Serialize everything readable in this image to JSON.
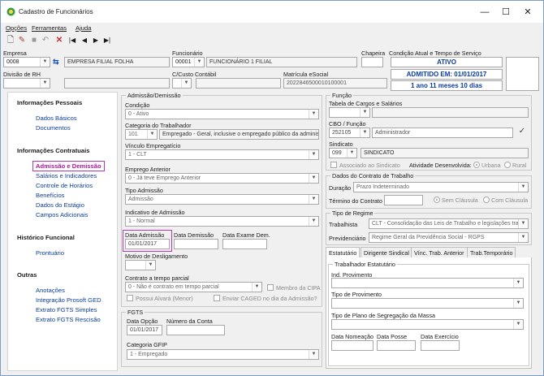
{
  "window": {
    "title": "Cadastro de Funcionários",
    "minimize": "—",
    "maximize": "☐",
    "close": "✕"
  },
  "menu": [
    "Opções",
    "Ferramentas",
    "Ajuda"
  ],
  "toolbar": {
    "new": "🗋",
    "edit": "✎",
    "save": "■",
    "undo": "↶",
    "delete": "✕",
    "first": "|◀",
    "prev": "◀",
    "next": "▶",
    "last": "▶|"
  },
  "header": {
    "empresa_label": "Empresa",
    "empresa_code": "0008",
    "empresa_name": "EMPRESA FILIAL FOLHA",
    "funcionario_label": "Funcionário",
    "funcionario_code": "00001",
    "funcionario_name": "FUNCIONÁRIO 1 FILIAL",
    "chapeira_label": "Chapeira",
    "condicao_label": "Condição Atual e Tempo de Serviço",
    "status": "ATIVO",
    "admitido": "ADMITIDO EM: 01/01/2017",
    "tempo": "1 ano 11 meses 10 dias",
    "divisao_label": "Divisão de RH",
    "custo_label": "C/Custo Contábil",
    "matricula_label": "Matrícula eSocial",
    "matricula_value": "2022846500010100001"
  },
  "sidebar": {
    "sections": [
      {
        "title": "Informações Pessoais",
        "items": [
          "Dados Básicos",
          "Documentos"
        ]
      },
      {
        "title": "Informações Contratuais",
        "items": [
          "Admissão e Demissão",
          "Salários e Indicadores",
          "Controle de Horários",
          "Benefícios",
          "Dados do Estágio",
          "Campos Adicionais"
        ]
      },
      {
        "title": "Histórico Funcional",
        "items": [
          "Prontuário"
        ]
      },
      {
        "title": "Outras",
        "items": [
          "Anotações",
          "Integração Prosoft GED",
          "Extrato FGTS Simples",
          "Extrato FGTS Rescisão"
        ]
      }
    ]
  },
  "admissao": {
    "group_title": "Admissão/Demissão",
    "condicao_label": "Condição",
    "condicao_value": "0 - Ativo",
    "categoria_label": "Categoria do Trabalhador",
    "categoria_code": "101",
    "categoria_desc": "Empregado - Geral, inclusive o empregado público da administ",
    "vinculo_label": "Vínculo Empregatício",
    "vinculo_value": "1 - CLT",
    "emprego_label": "Emprego Anterior",
    "emprego_value": "0 - Já teve Emprego Anterior",
    "tipo_admissao_label": "Tipo Admissão",
    "tipo_admissao_value": "Admissão",
    "indicativo_label": "Indicativo de Admissão",
    "indicativo_value": "1 - Normal",
    "data_admissao_label": "Data Admissão",
    "data_admissao_value": "01/01/2017",
    "data_demissao_label": "Data Demissão",
    "data_exame_label": "Data Exame Dem.",
    "motivo_label": "Motivo de Desligamento",
    "contrato_parcial_label": "Contrato a tempo parcial",
    "contrato_parcial_value": "0 - Não é contrato em tempo parcial",
    "membro_cipa": "Membro da CIPA",
    "possui_alvara": "Possui Alvará (Menor)",
    "enviar_caged": "Enviar CAGED no dia da Admissão?"
  },
  "fgts": {
    "group_title": "FGTS",
    "data_opcao_label": "Data Opção",
    "data_opcao_value": "01/01/2017",
    "numero_conta_label": "Número da Conta",
    "categoria_gfip_label": "Categoria GFIP",
    "categoria_gfip_value": "1 - Empregado"
  },
  "funcao": {
    "group_title": "Função",
    "tabela_label": "Tabela de Cargos e Salários",
    "cbo_label": "CBO / Função",
    "cbo_code": "252105",
    "cbo_desc": "Administrador",
    "sindicato_label": "Sindicato",
    "sindicato_code": "099",
    "sindicato_name": "SINDICATO",
    "associado": "Associado ao Sindicato",
    "atividade_label": "Atividade Desenvolvida:",
    "urbana": "Urbana",
    "rural": "Rural"
  },
  "contrato": {
    "group_title": "Dados do Contrato de Trabalho",
    "duracao_label": "Duração",
    "duracao_value": "Prazo Indeterminado",
    "termino_label": "Término do Contrato",
    "sem_clausula": "Sem Cláusula",
    "com_clausula": "Com Cláusula"
  },
  "regime": {
    "group_title": "Tipo de Regime",
    "trabalhista_label": "Trabalhista",
    "trabalhista_value": "CLT - Consolidação das Leis de Trabalho e legislações tra",
    "previdenciario_label": "Previdenciário",
    "previdenciario_value": "Regime Geral da Previdência Social - RGPS"
  },
  "tabs": [
    "Estatutário",
    "Dirigente Sindical",
    "Vínc. Trab. Anterior",
    "Trab.Temporário"
  ],
  "estatutario": {
    "group_title": "Trabalhador Estatutário",
    "ind_provimento_label": "Ind. Provimento",
    "tipo_provimento_label": "Tipo de Provimento",
    "tipo_plano_label": "Tipo de Plano de Segregação da Massa",
    "data_nomeacao_label": "Data Nomeação",
    "data_posse_label": "Data Posse",
    "data_exercicio_label": "Data Exercício"
  }
}
